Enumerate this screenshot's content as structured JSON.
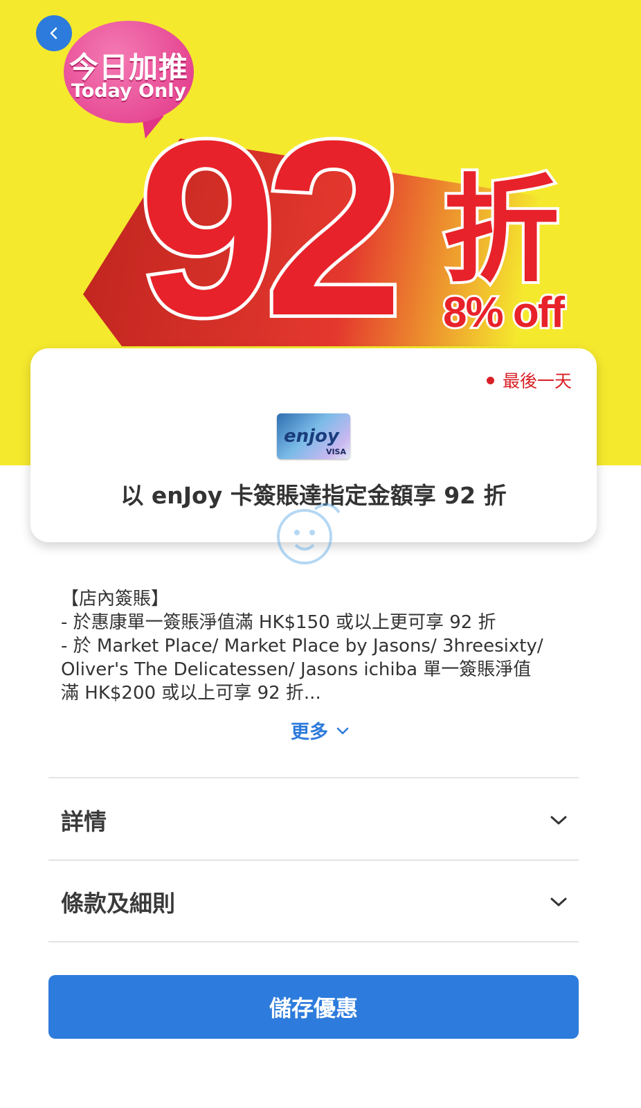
{
  "colors": {
    "accent": "#2d7bdc",
    "banner_yellow": "#f5e92e",
    "promo_red": "#e8222a",
    "bubble_pink": "#e03486"
  },
  "banner": {
    "bubble_cn": "今日加推",
    "bubble_en": "Today Only",
    "big_number": "92",
    "big_suffix": "折",
    "off_text": "8% off"
  },
  "offer_card": {
    "status": "最後一天",
    "card_brand": "enjoy",
    "card_network": "VISA",
    "title": "以 enJoy 卡簽賬達指定金額享 92 折"
  },
  "description": {
    "lines": [
      "【店內簽賬】",
      "- 於惠康單一簽賬淨值滿 HK$150 或以上更可享 92 折",
      "- 於 Market Place/ Market Place by Jasons/ 3hreesixty/",
      "Oliver's The Delicatessen/ Jasons ichiba 單一簽賬淨值",
      "滿 HK$200 或以上可享 92 折..."
    ],
    "more_label": "更多"
  },
  "sections": [
    {
      "label": "詳情"
    },
    {
      "label": "條款及細則"
    }
  ],
  "save_button": "儲存優惠",
  "icons": {
    "back": "chevron-left-icon",
    "expand": "chevron-down-icon"
  }
}
